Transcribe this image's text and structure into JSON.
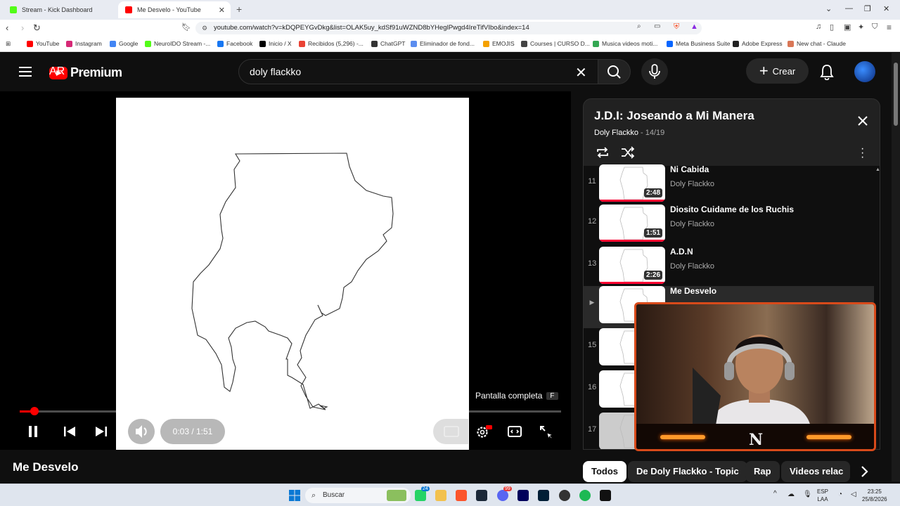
{
  "browser": {
    "tabs": [
      {
        "title": "Stream - Kick Dashboard",
        "color": "#53fc18"
      },
      {
        "title": "Me Desvelo - YouTube",
        "color": "#ff0000"
      }
    ],
    "url": "youtube.com/watch?v=kDQPEYGvDkg&list=OLAK5uy_kdSf91uWZND8bYHeglPwgd4IreTifVIbo&index=14",
    "bookmarks": [
      {
        "label": "YouTube",
        "color": "#ff0000"
      },
      {
        "label": "Instagram",
        "color": "#d62976"
      },
      {
        "label": "Google",
        "color": "#4285f4"
      },
      {
        "label": "NeuroIDO Stream -...",
        "color": "#53fc18"
      },
      {
        "label": "Facebook",
        "color": "#1877f2"
      },
      {
        "label": "Inicio / X",
        "color": "#000000"
      },
      {
        "label": "Recibidos (5,296) -...",
        "color": "#ea4335"
      },
      {
        "label": "ChatGPT",
        "color": "#333333"
      },
      {
        "label": "Eliminador de fond...",
        "color": "#5b8def"
      },
      {
        "label": "EMOJIS",
        "color": "#f4a100"
      },
      {
        "label": "Courses | CURSO D...",
        "color": "#444444"
      },
      {
        "label": "Musica videos moti...",
        "color": "#34a853"
      },
      {
        "label": "Meta Business Suite",
        "color": "#0866ff"
      },
      {
        "label": "Adobe Express",
        "color": "#222222"
      },
      {
        "label": "New chat - Claude",
        "color": "#d97757"
      }
    ]
  },
  "youtube": {
    "logo_text": "Premium",
    "region": "AR",
    "search": {
      "query": "doly flackko"
    },
    "create_label": "Crear",
    "player": {
      "tooltip": "Pantalla completa",
      "tooltip_key": "F",
      "time": "0:03 / 1:51",
      "progress_fraction": 0.027,
      "title": "Me Desvelo"
    },
    "playlist": {
      "title": "J.D.I: Joseando a Mi Manera",
      "artist": "Doly Flackko",
      "position": "14/19",
      "items": [
        {
          "num": "11",
          "name": "Ni Cabida",
          "artist": "Doly Flackko",
          "duration": "2:48"
        },
        {
          "num": "12",
          "name": "Diosito Cuidame de los Ruchis",
          "artist": "Doly Flackko",
          "duration": "1:51"
        },
        {
          "num": "13",
          "name": "A.D.N",
          "artist": "Doly Flackko",
          "duration": "2:26"
        },
        {
          "num": "▶",
          "name": "Me Desvelo",
          "artist": "",
          "duration": ""
        },
        {
          "num": "15",
          "name": "",
          "artist": "",
          "duration": ""
        },
        {
          "num": "16",
          "name": "",
          "artist": "",
          "duration": ""
        },
        {
          "num": "17",
          "name": "",
          "artist": "",
          "duration": ""
        }
      ]
    },
    "chips": [
      "Todos",
      "De Doly Flackko - Topic",
      "Rap",
      "Videos relac"
    ]
  },
  "taskbar": {
    "search": "Buscar",
    "badge_whatsapp": "24",
    "badge_discord": "99",
    "lang": "ESP",
    "lang2": "LAA",
    "time": "23:25",
    "date": "25/8/2026"
  }
}
